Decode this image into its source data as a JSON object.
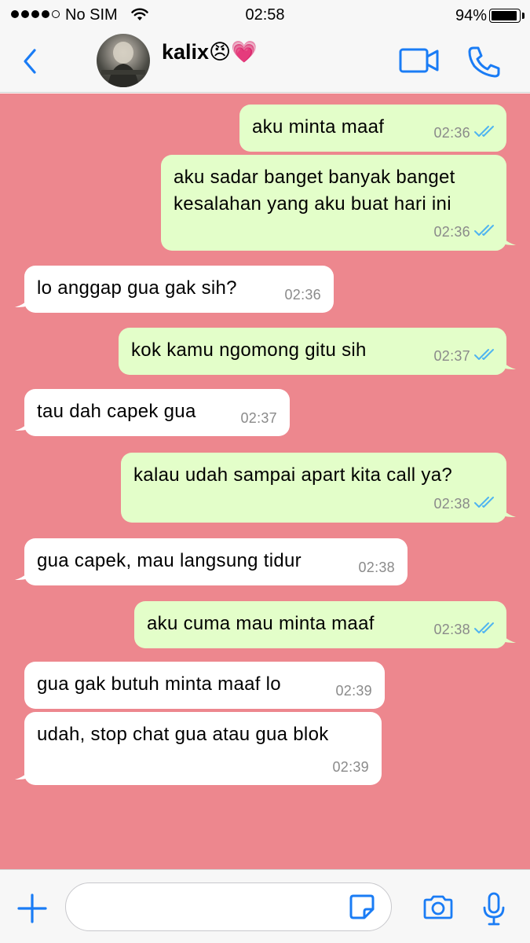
{
  "status_bar": {
    "carrier": "No SIM",
    "time": "02:58",
    "battery": "94%",
    "battery_level": 0.94
  },
  "header": {
    "contact_name": "kalix😠💗",
    "icons": [
      "back-chevron-icon",
      "video-call-icon",
      "phone-icon"
    ]
  },
  "colors": {
    "accent": "#1a7cf5",
    "chat_background": "#ed878e",
    "outgoing_bubble": "#e3fec9",
    "incoming_bubble": "#ffffff",
    "read_ticks": "#4fb4f0"
  },
  "messages": [
    {
      "direction": "out",
      "text": "aku minta maaf",
      "time": "02:36",
      "read": true
    },
    {
      "direction": "out",
      "text": "aku sadar banget banyak banget\nkesalahan yang aku buat hari ini",
      "time": "02:36",
      "read": true
    },
    {
      "direction": "in",
      "text": "lo anggap gua gak sih?",
      "time": "02:36"
    },
    {
      "direction": "out",
      "text": "kok kamu ngomong gitu sih",
      "time": "02:37",
      "read": true
    },
    {
      "direction": "in",
      "text": "tau dah capek gua",
      "time": "02:37"
    },
    {
      "direction": "out",
      "text": "kalau udah sampai apart kita call ya?",
      "time": "02:38",
      "read": true
    },
    {
      "direction": "in",
      "text": "gua capek, mau langsung tidur",
      "time": "02:38"
    },
    {
      "direction": "out",
      "text": "aku cuma mau minta maaf",
      "time": "02:38",
      "read": true
    },
    {
      "direction": "in",
      "text": "gua gak butuh minta maaf lo",
      "time": "02:39"
    },
    {
      "direction": "in",
      "text": "udah, stop chat gua atau gua blok",
      "time": "02:39"
    }
  ],
  "input_bar": {
    "message_field_value": "",
    "icons": [
      "plus-icon",
      "sticker-icon",
      "camera-icon",
      "microphone-icon"
    ]
  }
}
